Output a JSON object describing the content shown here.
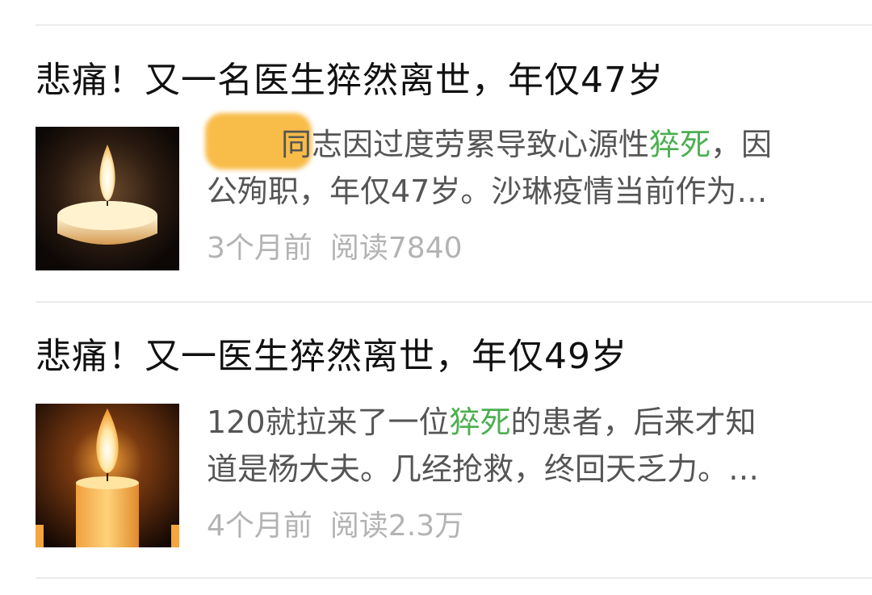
{
  "articles": [
    {
      "title": "悲痛！又一名医生猝然离世，年仅47岁",
      "summary": {
        "line1_a": "同志因过度劳累导致心源性",
        "line1_hl": "猝死",
        "line1_b": "，因",
        "line2": "公殉职，年仅47岁。沙琳疫情当前作为…"
      },
      "time": "3个月前",
      "reads": "阅读7840",
      "thumbnail_icon": "candle-icon"
    },
    {
      "title": "悲痛！又一医生猝然离世，年仅49岁",
      "summary": {
        "line1_a": "120就拉来了一位",
        "line1_hl": "猝死",
        "line1_b": "的患者，后来才知",
        "line2": "道是杨大夫。几经抢救，终回天乏力。…"
      },
      "time": "4个月前",
      "reads": "阅读2.3万",
      "thumbnail_icon": "candle-icon"
    }
  ],
  "colors": {
    "highlight": "#4caf50",
    "title": "#111111",
    "summary": "#555555",
    "meta": "#b3b3b3",
    "redaction": "#f8b940"
  }
}
